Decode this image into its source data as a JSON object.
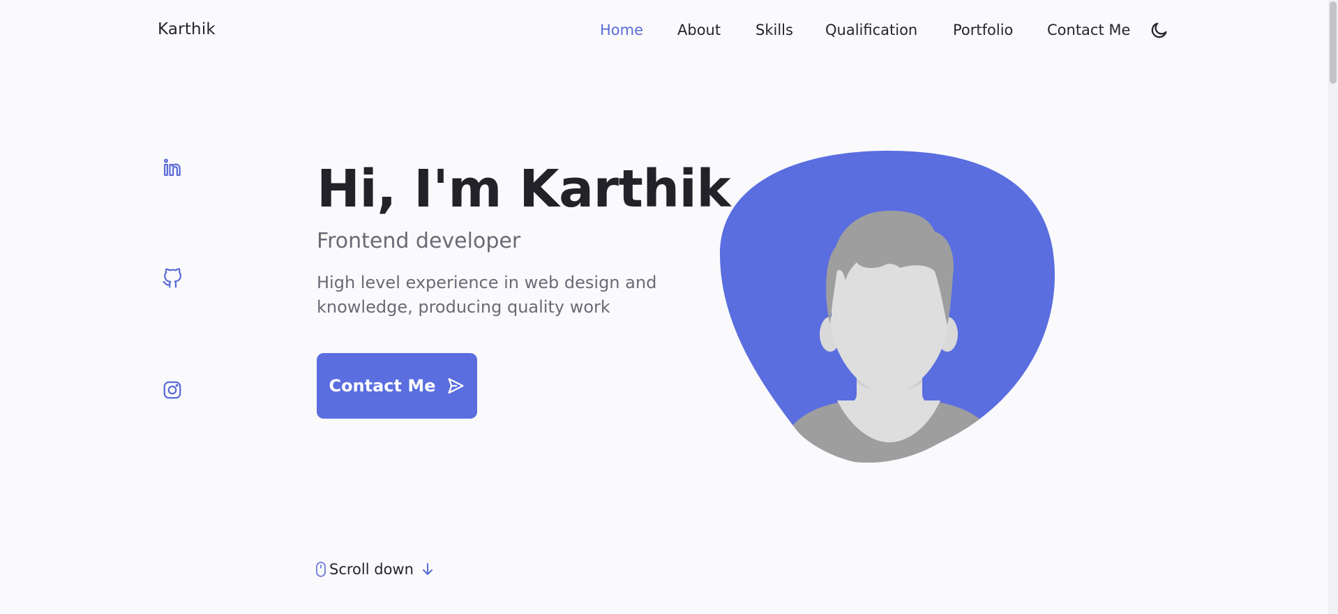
{
  "header": {
    "logo": "Karthik",
    "nav": [
      {
        "label": "Home",
        "active": true
      },
      {
        "label": "About"
      },
      {
        "label": "Skills"
      },
      {
        "label": "Qualification"
      },
      {
        "label": "Portfolio"
      },
      {
        "label": "Contact Me"
      }
    ],
    "theme_icon": "moon-icon"
  },
  "social": [
    "linkedin-icon",
    "github-icon",
    "instagram-icon"
  ],
  "hero": {
    "title": "Hi, I'm Karthik",
    "subtitle": "Frontend developer",
    "description": "High level experience in web design and knowledge, producing quality work",
    "cta_label": "Contact Me",
    "cta_icon": "send-icon"
  },
  "scroll": {
    "label": "Scroll down",
    "icons": [
      "mouse-icon",
      "arrow-down-icon"
    ]
  },
  "colors": {
    "accent": "#5a6ee0",
    "background": "#fafafc",
    "title": "#222228",
    "muted": "#6a6a75",
    "avatar_hair": "#9e9e9e",
    "avatar_skin": "#dedede"
  }
}
